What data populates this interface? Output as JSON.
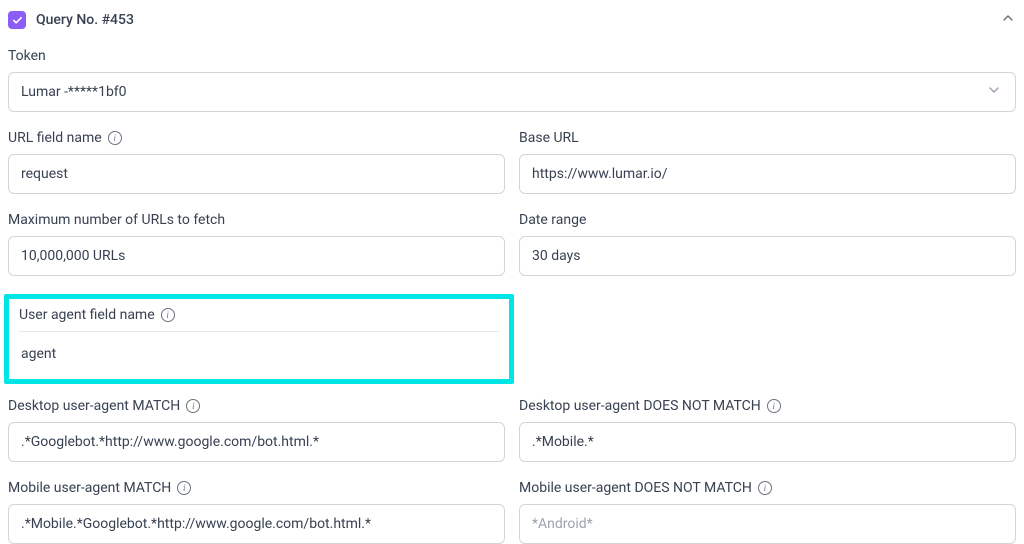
{
  "header": {
    "title": "Query No. #453"
  },
  "token": {
    "label": "Token",
    "value": "Lumar -*****1bf0"
  },
  "url_field_name": {
    "label": "URL field name",
    "value": "request"
  },
  "base_url": {
    "label": "Base URL",
    "value": "https://www.lumar.io/"
  },
  "max_urls": {
    "label": "Maximum number of URLs to fetch",
    "value": "10,000,000 URLs"
  },
  "date_range": {
    "label": "Date range",
    "value": "30 days"
  },
  "user_agent_field": {
    "label": "User agent field name",
    "value": "agent"
  },
  "desktop_match": {
    "label": "Desktop user-agent MATCH",
    "value": ".*Googlebot.*http://www.google.com/bot.html.*"
  },
  "desktop_not_match": {
    "label": "Desktop user-agent DOES NOT MATCH",
    "value": ".*Mobile.*"
  },
  "mobile_match": {
    "label": "Mobile user-agent MATCH",
    "value": ".*Mobile.*Googlebot.*http://www.google.com/bot.html.*"
  },
  "mobile_not_match": {
    "label": "Mobile user-agent DOES NOT MATCH",
    "placeholder": "*Android*"
  }
}
